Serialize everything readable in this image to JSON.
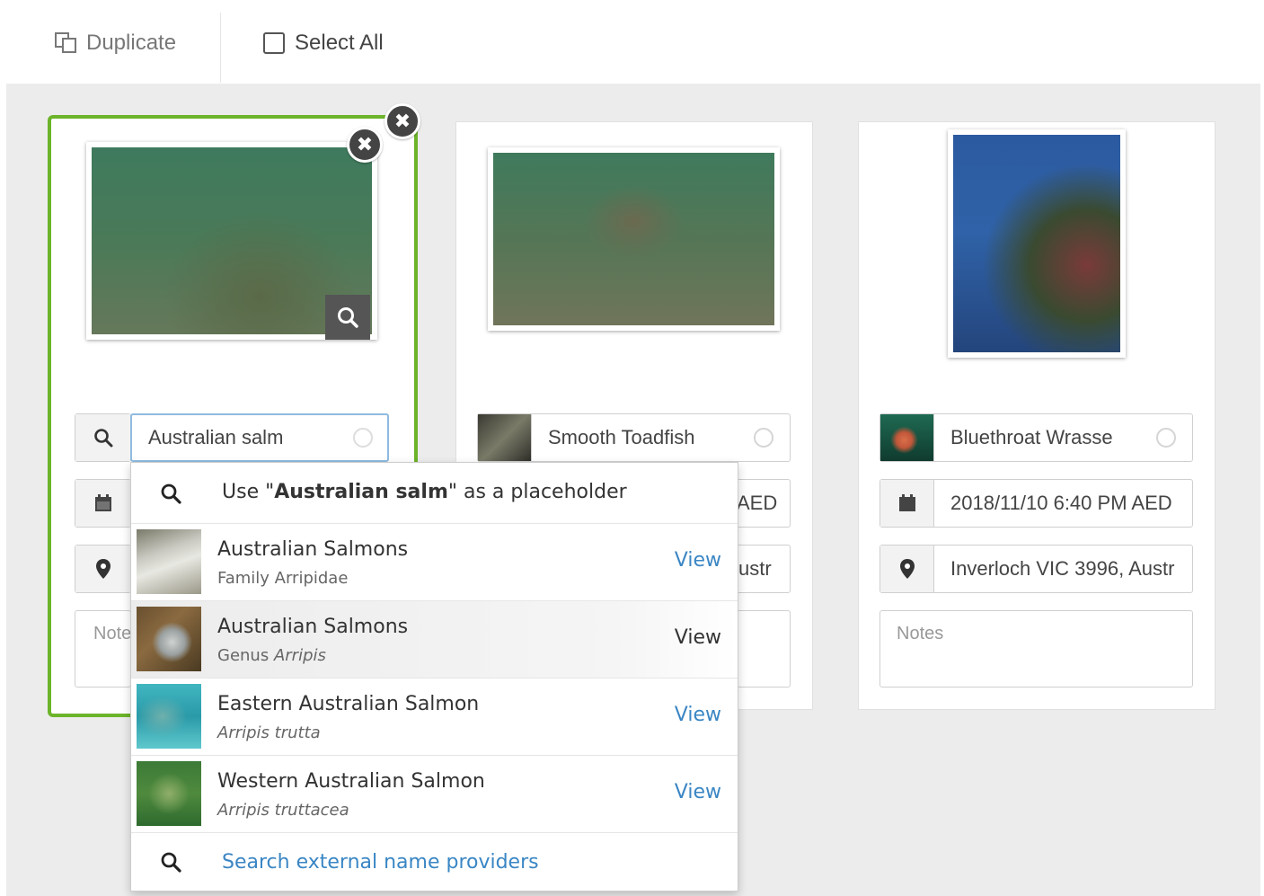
{
  "toolbar": {
    "duplicate_label": "Duplicate",
    "select_all_label": "Select All"
  },
  "cards": [
    {
      "selected": true,
      "taxon_input": {
        "value": "Australian salm",
        "icon": "search-icon"
      },
      "notes_placeholder": "Notes"
    },
    {
      "taxon_name": "Smooth Toadfish",
      "datetime_partial": "AED",
      "location_partial": "ustr"
    },
    {
      "taxon_name": "Bluethroat Wrasse",
      "datetime": "2018/11/10 6:40 PM AED",
      "location": "Inverloch VIC 3996, Austr",
      "notes_placeholder": "Notes"
    }
  ],
  "dropdown": {
    "placeholder_prefix": "Use \"",
    "placeholder_term": "Australian salm",
    "placeholder_suffix": "\" as a placeholder",
    "results": [
      {
        "name": "Australian Salmons",
        "rank": "Family",
        "sci": "Arripidae",
        "sci_italic": false,
        "view": "View"
      },
      {
        "name": "Australian Salmons",
        "rank": "Genus",
        "sci": "Arripis",
        "sci_italic": true,
        "view": "View",
        "hover": true
      },
      {
        "name": "Eastern Australian Salmon",
        "rank": "",
        "sci": "Arripis trutta",
        "sci_italic": true,
        "view": "View"
      },
      {
        "name": "Western Australian Salmon",
        "rank": "",
        "sci": "Arripis truttacea",
        "sci_italic": true,
        "view": "View"
      }
    ],
    "external_label": "Search external name providers"
  },
  "colors": {
    "selected_border": "#6cb42a",
    "link": "#3a86c4",
    "background": "#ececec"
  }
}
